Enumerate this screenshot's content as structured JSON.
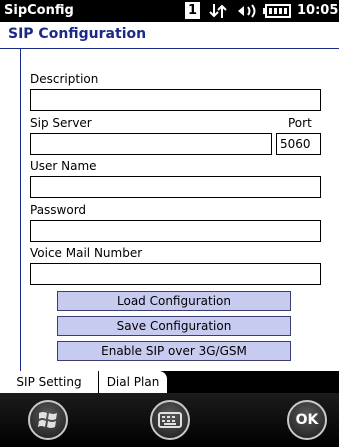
{
  "topbar": {
    "app_title": "SipConfig",
    "status_number": "1",
    "clock": "10:05",
    "icons": [
      "data-connection-icon",
      "speaker-icon",
      "battery-icon"
    ]
  },
  "header": {
    "title": "SIP Configuration"
  },
  "form": {
    "description_label": "Description",
    "description_value": "",
    "sip_server_label": "Sip Server",
    "sip_server_value": "",
    "port_label": "Port",
    "port_value": "5060",
    "user_name_label": "User Name",
    "user_name_value": "",
    "password_label": "Password",
    "password_value": "",
    "voice_mail_label": "Voice Mail Number",
    "voice_mail_value": ""
  },
  "buttons": {
    "load_label": "Load Configuration",
    "save_label": "Save Configuration",
    "enable_label": "Enable SIP over 3G/GSM"
  },
  "tabs": [
    {
      "label": "SIP Setting",
      "active": true
    },
    {
      "label": "Dial Plan",
      "active": false
    }
  ],
  "softkeys": {
    "start_icon": "windows-start-icon",
    "keyboard_icon": "keyboard-icon",
    "ok_label": "OK"
  },
  "colors": {
    "header_text": "#1b2a86",
    "button_fill": "#c8cbf0",
    "bar_background": "#000000"
  }
}
